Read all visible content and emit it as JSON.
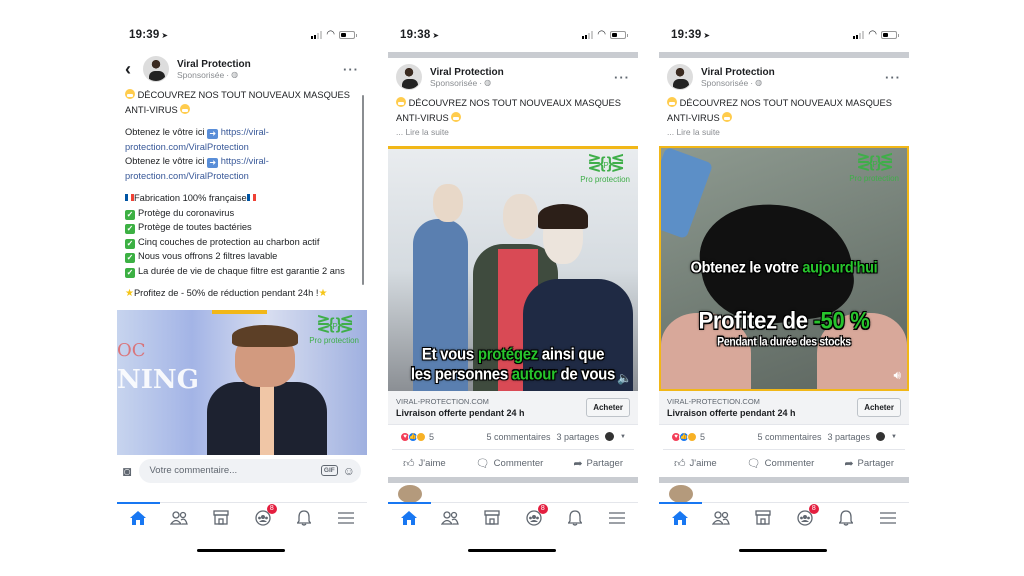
{
  "screens": [
    {
      "status": {
        "time": "19:39"
      },
      "post": {
        "author": "Viral Protection",
        "sponsored": "Sponsorisée",
        "headline": "DÉCOUVREZ NOS TOUT NOUVEAUX MASQUES ANTI-VIRUS",
        "get_yours_1": "Obtenez le vôtre ici",
        "link_1": "https://viral-protection.com/ViralProtection",
        "get_yours_2": "Obtenez le vôtre ici",
        "link_2": "https://viral-protection.com/ViralProtection",
        "made_in": "Fabrication 100% française",
        "features": [
          "Protège du coronavirus",
          "Protège de toutes bactéries",
          "Cinq couches de protection au charbon actif",
          "Nous vous offrons 2 filtres lavable",
          "La durée de vie de chaque filtre est garantie 2 ans"
        ],
        "promo": "Profitez de - 50% de réduction pendant 24h !",
        "media": {
          "logo_text": "Pro protection",
          "logo_letter": "P",
          "bg_word": "NING",
          "bg_word_top": "OC"
        }
      },
      "comment_bar": {
        "placeholder": "Votre commentaire...",
        "gif": "GIF"
      }
    },
    {
      "status": {
        "time": "19:38"
      },
      "post": {
        "author": "Viral Protection",
        "sponsored": "Sponsorisée",
        "headline": "DÉCOUVREZ NOS TOUT NOUVEAUX MASQUES ANTI-VIRUS",
        "read_more": "... Lire la suite",
        "media": {
          "logo_text": "Pro protection",
          "logo_letter": "P",
          "caption_line1_a": "Et vous ",
          "caption_line1_b": "protégez",
          "caption_line1_c": " ainsi que",
          "caption_line2_a": "les personnes ",
          "caption_line2_b": "autour",
          "caption_line2_c": " de vous"
        },
        "link": {
          "domain": "VIRAL-PROTECTION.COM",
          "title": "Livraison offerte pendant 24 h",
          "cta": "Acheter"
        },
        "reactions_count": "5",
        "comments": "5 commentaires",
        "shares": "3 partages",
        "actions": {
          "like": "J'aime",
          "comment": "Commenter",
          "share": "Partager"
        }
      }
    },
    {
      "status": {
        "time": "19:39"
      },
      "post": {
        "author": "Viral Protection",
        "sponsored": "Sponsorisée",
        "headline": "DÉCOUVREZ NOS TOUT NOUVEAUX MASQUES ANTI-VIRUS",
        "read_more": "... Lire la suite",
        "media": {
          "logo_text": "Pro protection",
          "logo_letter": "P",
          "caption_line1_a": "Obtenez le votre ",
          "caption_line1_b": "aujourd'hui",
          "caption_line2_a": "Profitez de ",
          "caption_line2_b": "-50 %",
          "caption_line3": "Pendant la durée des stocks"
        },
        "link": {
          "domain": "VIRAL-PROTECTION.COM",
          "title": "Livraison offerte pendant 24 h",
          "cta": "Acheter"
        },
        "reactions_count": "5",
        "comments": "5 commentaires",
        "shares": "3 partages",
        "actions": {
          "like": "J'aime",
          "comment": "Commenter",
          "share": "Partager"
        }
      }
    }
  ],
  "tab_bar": {
    "tabs": [
      "home",
      "friends",
      "marketplace",
      "groups",
      "notifications",
      "menu"
    ],
    "groups_badge": "8"
  },
  "colors": {
    "accent": "#1877f2",
    "link": "#385898",
    "badge": "#e41e3f",
    "brand_green": "#3fae49",
    "caption_green": "#27c42c",
    "ad_border": "#f1b718"
  }
}
